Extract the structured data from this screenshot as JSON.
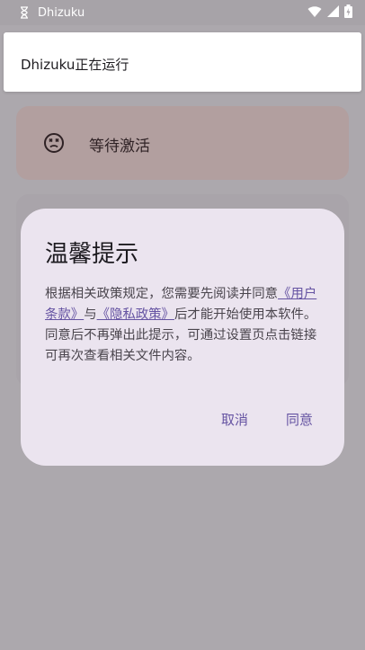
{
  "status_bar": {
    "app_name": "Dhizuku",
    "left_icon": "hourglass-icon",
    "right_icons": [
      "wifi-icon",
      "signal-icon",
      "battery-icon"
    ]
  },
  "notification": {
    "text": "Dhizuku正在运行"
  },
  "status_card": {
    "icon": "dizzy-face-icon",
    "text": "等待激活"
  },
  "dialog": {
    "title": "温馨提示",
    "body_before": "根据相关政策规定，您需要先阅读并同意",
    "link_terms": "《用户条款》",
    "body_and": "与",
    "link_privacy": "《隐私政策》",
    "body_after": "后才能开始使用本软件。同意后不再弹出此提示，可通过设置页点击链接可再次查看相关文件内容。",
    "cancel_label": "取消",
    "agree_label": "同意"
  },
  "colors": {
    "scrim": "#aca8ad",
    "dialog_bg": "#ebe4ef",
    "accent": "#6553a2",
    "status_card_bg": "#b29f9f"
  }
}
